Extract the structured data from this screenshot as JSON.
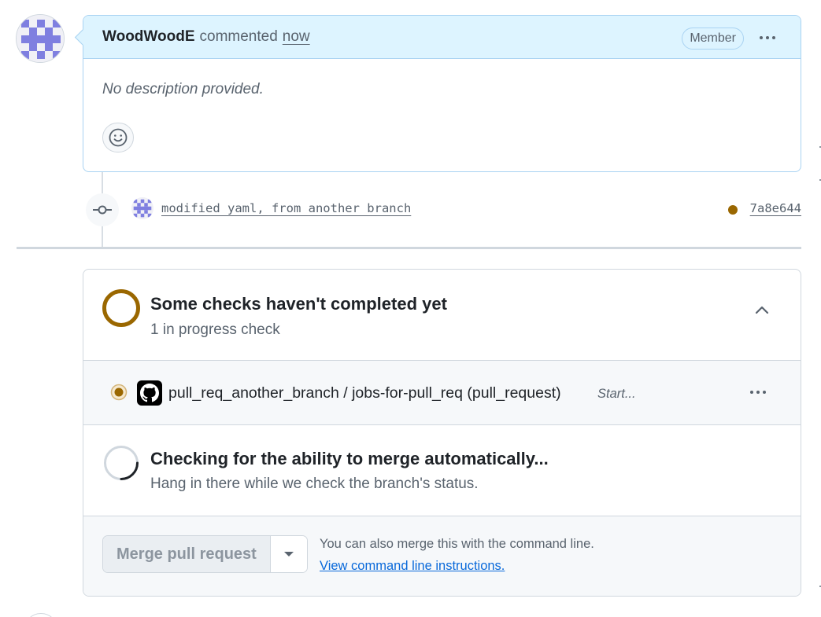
{
  "comment": {
    "author": "WoodWoodE",
    "action": "commented",
    "time": "now",
    "badge": "Member",
    "body": "No description provided."
  },
  "commit": {
    "message": "modified yaml, from another branch",
    "sha": "7a8e644",
    "status_color": "#9a6700"
  },
  "checks": {
    "title": "Some checks haven't completed yet",
    "subtitle": "1 in progress check",
    "items": [
      {
        "name": "pull_req_another_branch / jobs-for-pull_req (pull_request)",
        "state": "Start..."
      }
    ]
  },
  "mergeability": {
    "title": "Checking for the ability to merge automatically...",
    "subtitle": "Hang in there while we check the branch's status."
  },
  "merge": {
    "button_label": "Merge pull request",
    "hint": "You can also merge this with the command line.",
    "link": "View command line instructions."
  },
  "colors": {
    "pending": "#9a6700",
    "link": "#0969da",
    "header_bg": "#ddf4ff"
  }
}
